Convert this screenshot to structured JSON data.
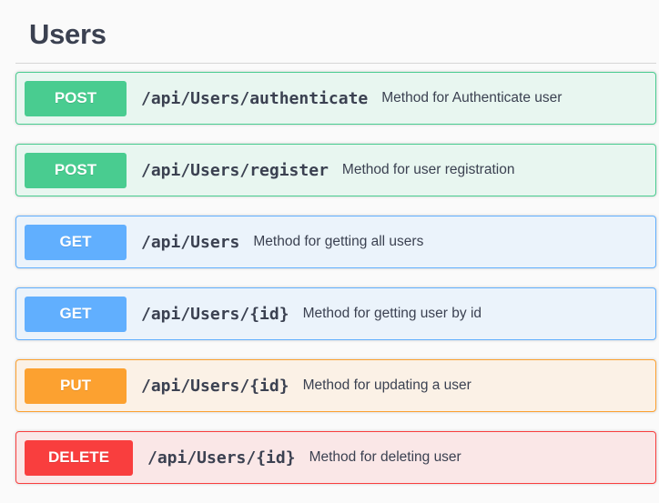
{
  "section": {
    "title": "Users"
  },
  "operations": [
    {
      "method": "POST",
      "path": "/api/Users/authenticate",
      "description": "Method for Authenticate user"
    },
    {
      "method": "POST",
      "path": "/api/Users/register",
      "description": "Method for user registration"
    },
    {
      "method": "GET",
      "path": "/api/Users",
      "description": "Method for getting all users"
    },
    {
      "method": "GET",
      "path": "/api/Users/{id}",
      "description": "Method for getting user by id"
    },
    {
      "method": "PUT",
      "path": "/api/Users/{id}",
      "description": "Method for updating a user"
    },
    {
      "method": "DELETE",
      "path": "/api/Users/{id}",
      "description": "Method for deleting user"
    }
  ],
  "colors": {
    "post": "#49cc90",
    "get": "#61affe",
    "put": "#fca130",
    "delete": "#f93e3e",
    "text": "#3b4151"
  }
}
